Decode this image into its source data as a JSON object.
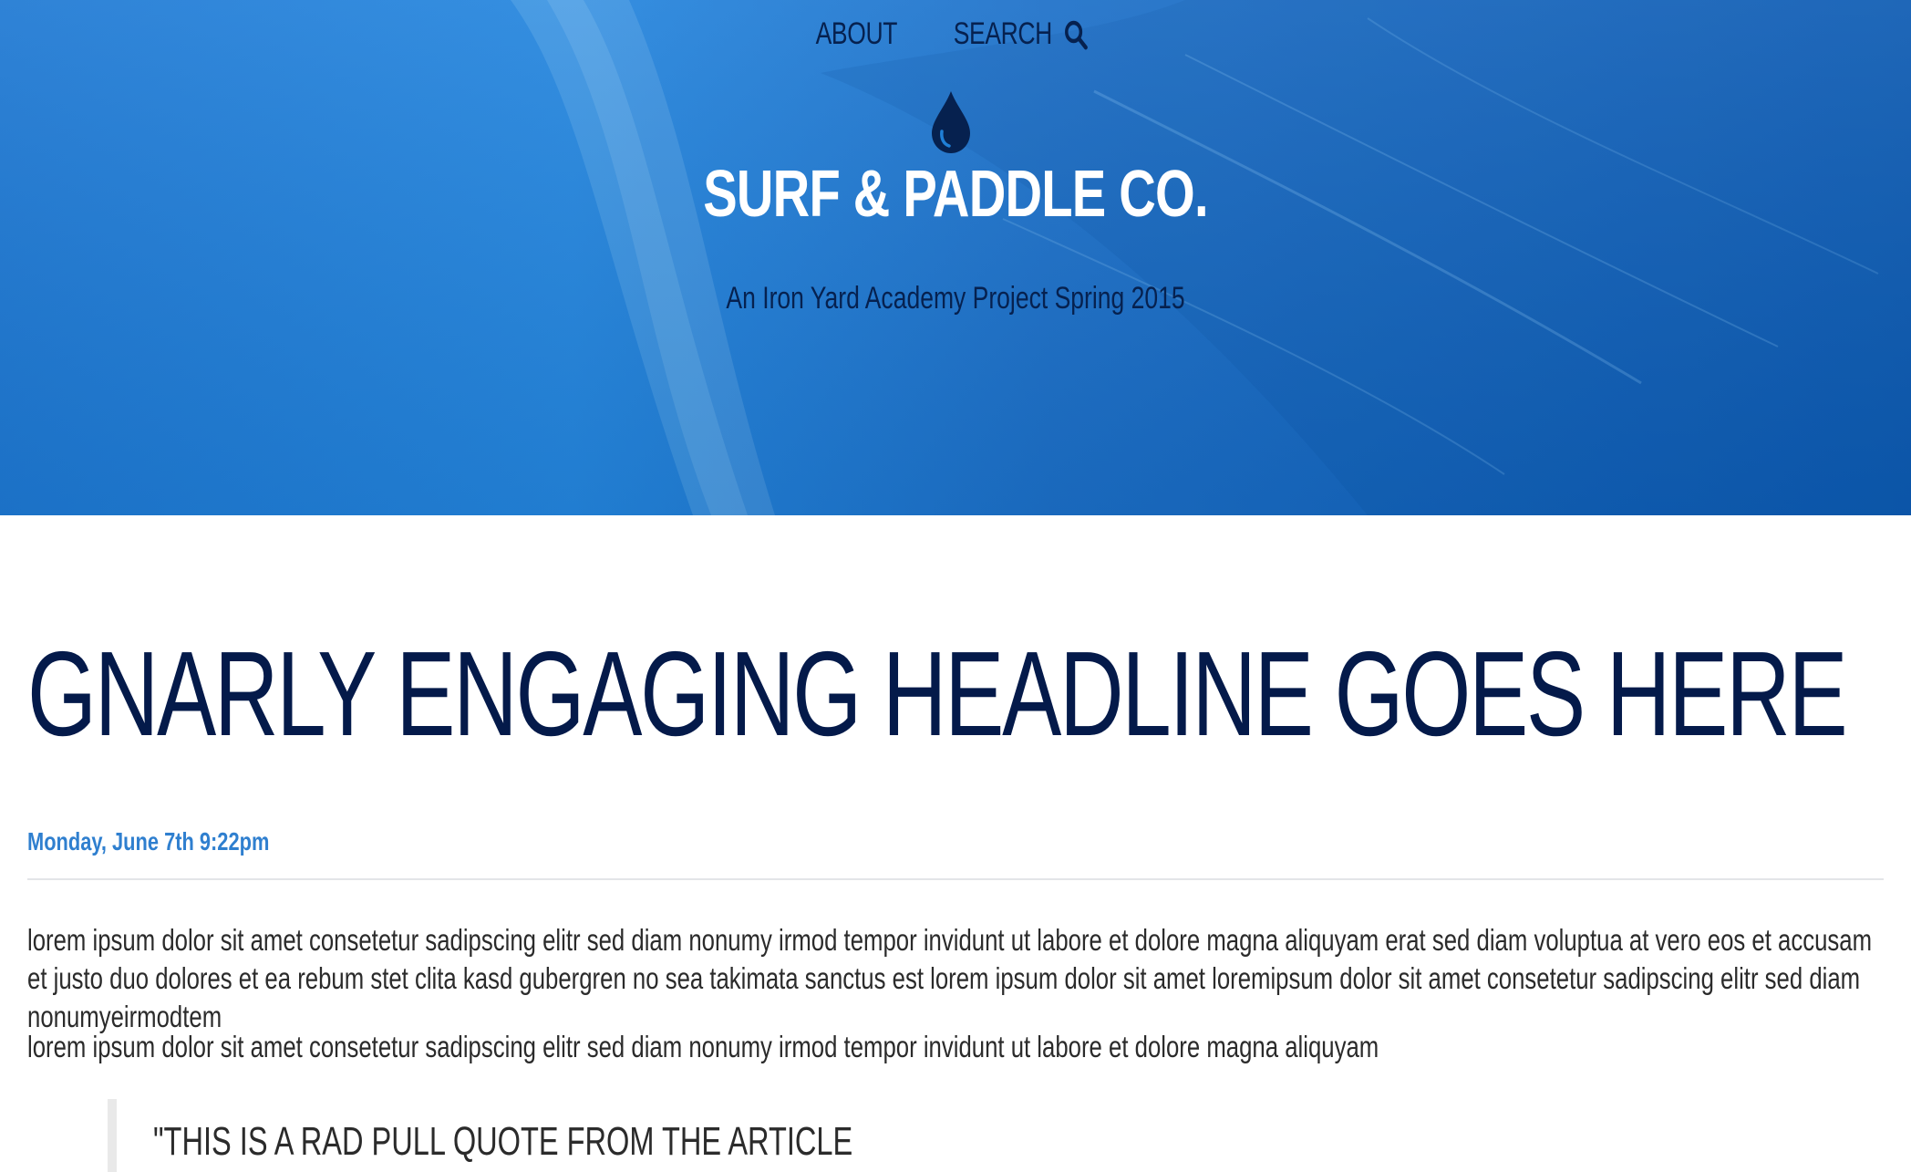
{
  "nav": {
    "about_label": "ABOUT",
    "search_label": "SEARCH",
    "search_icon": "search-icon"
  },
  "hero": {
    "logo_icon": "water-drop-icon",
    "brand": "SURF & PADDLE CO.",
    "tagline": "An Iron Yard Academy Project Spring 2015",
    "colors": {
      "background": "#1f7fd6",
      "dark_text": "#06214f",
      "brand_text": "#ffffff"
    }
  },
  "article": {
    "headline": "GNARLY ENGAGING HEADLINE GOES HERE",
    "date": "Monday, June 7th 9:22pm",
    "paragraphs": [
      "lorem ipsum dolor sit amet consetetur sadipscing elitr sed diam nonumy irmod tempor invidunt ut labore et dolore magna aliquyam erat sed diam voluptua at vero eos et accusam et justo duo dolores et ea rebum stet clita kasd gubergren no sea takimata sanctus est lorem ipsum dolor sit amet loremipsum dolor sit amet consetetur sadipscing elitr sed diam nonumyeirmodtem",
      "lorem ipsum dolor sit amet consetetur sadipscing elitr sed diam nonumy irmod tempor invidunt ut labore et dolore magna aliquyam"
    ],
    "pull_quote": "\"THIS IS A RAD PULL QUOTE FROM THE ARTICLE",
    "colors": {
      "headline": "#041a4a",
      "date": "#2f7fcf",
      "body_text": "#2b2b2b"
    }
  }
}
